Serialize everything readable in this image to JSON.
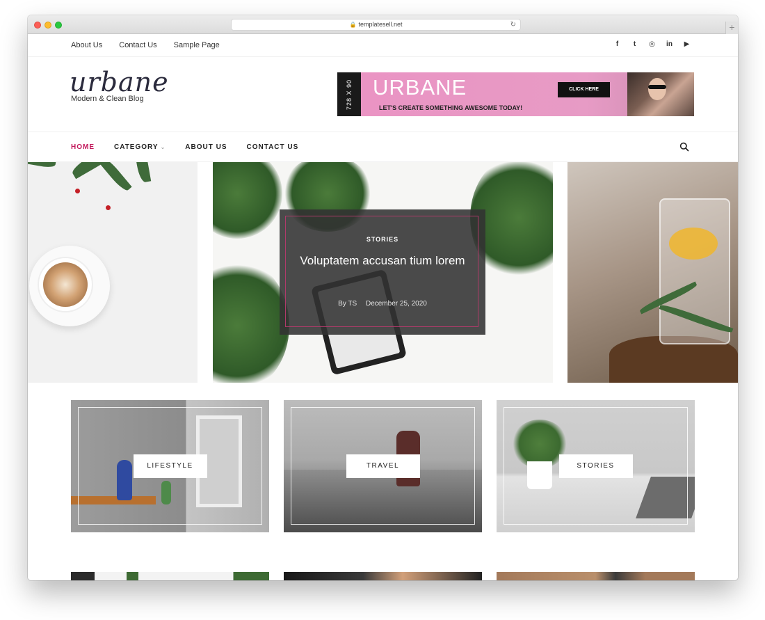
{
  "browser": {
    "url": "templatesell.net",
    "new_tab_icon": "+"
  },
  "topbar": {
    "links": [
      "About Us",
      "Contact Us",
      "Sample Page"
    ],
    "social_icons": [
      "facebook-icon",
      "twitter-icon",
      "instagram-icon",
      "linkedin-icon",
      "youtube-icon"
    ],
    "social_glyphs": [
      "f",
      "t",
      "◎",
      "in",
      "▶"
    ]
  },
  "header": {
    "logo_name": "urbane",
    "logo_tagline": "Modern & Clean Blog",
    "banner": {
      "size_label": "728 X 90",
      "title": "URBANE",
      "subtitle": "LET'S CREATE SOMETHING AWESOME TODAY!",
      "cta": "CLICK HERE"
    }
  },
  "nav": {
    "items": [
      {
        "label": "HOME",
        "active": true
      },
      {
        "label": "CATEGORY",
        "has_dropdown": true
      },
      {
        "label": "ABOUT US"
      },
      {
        "label": "CONTACT US"
      }
    ],
    "accent_color": "#c2185b"
  },
  "featured": {
    "category": "STORIES",
    "title": "Voluptatem accusan tium lorem",
    "author": "By TS",
    "date": "December 25, 2020"
  },
  "categories": [
    {
      "label": "LIFESTYLE"
    },
    {
      "label": "TRAVEL"
    },
    {
      "label": "STORIES"
    }
  ]
}
